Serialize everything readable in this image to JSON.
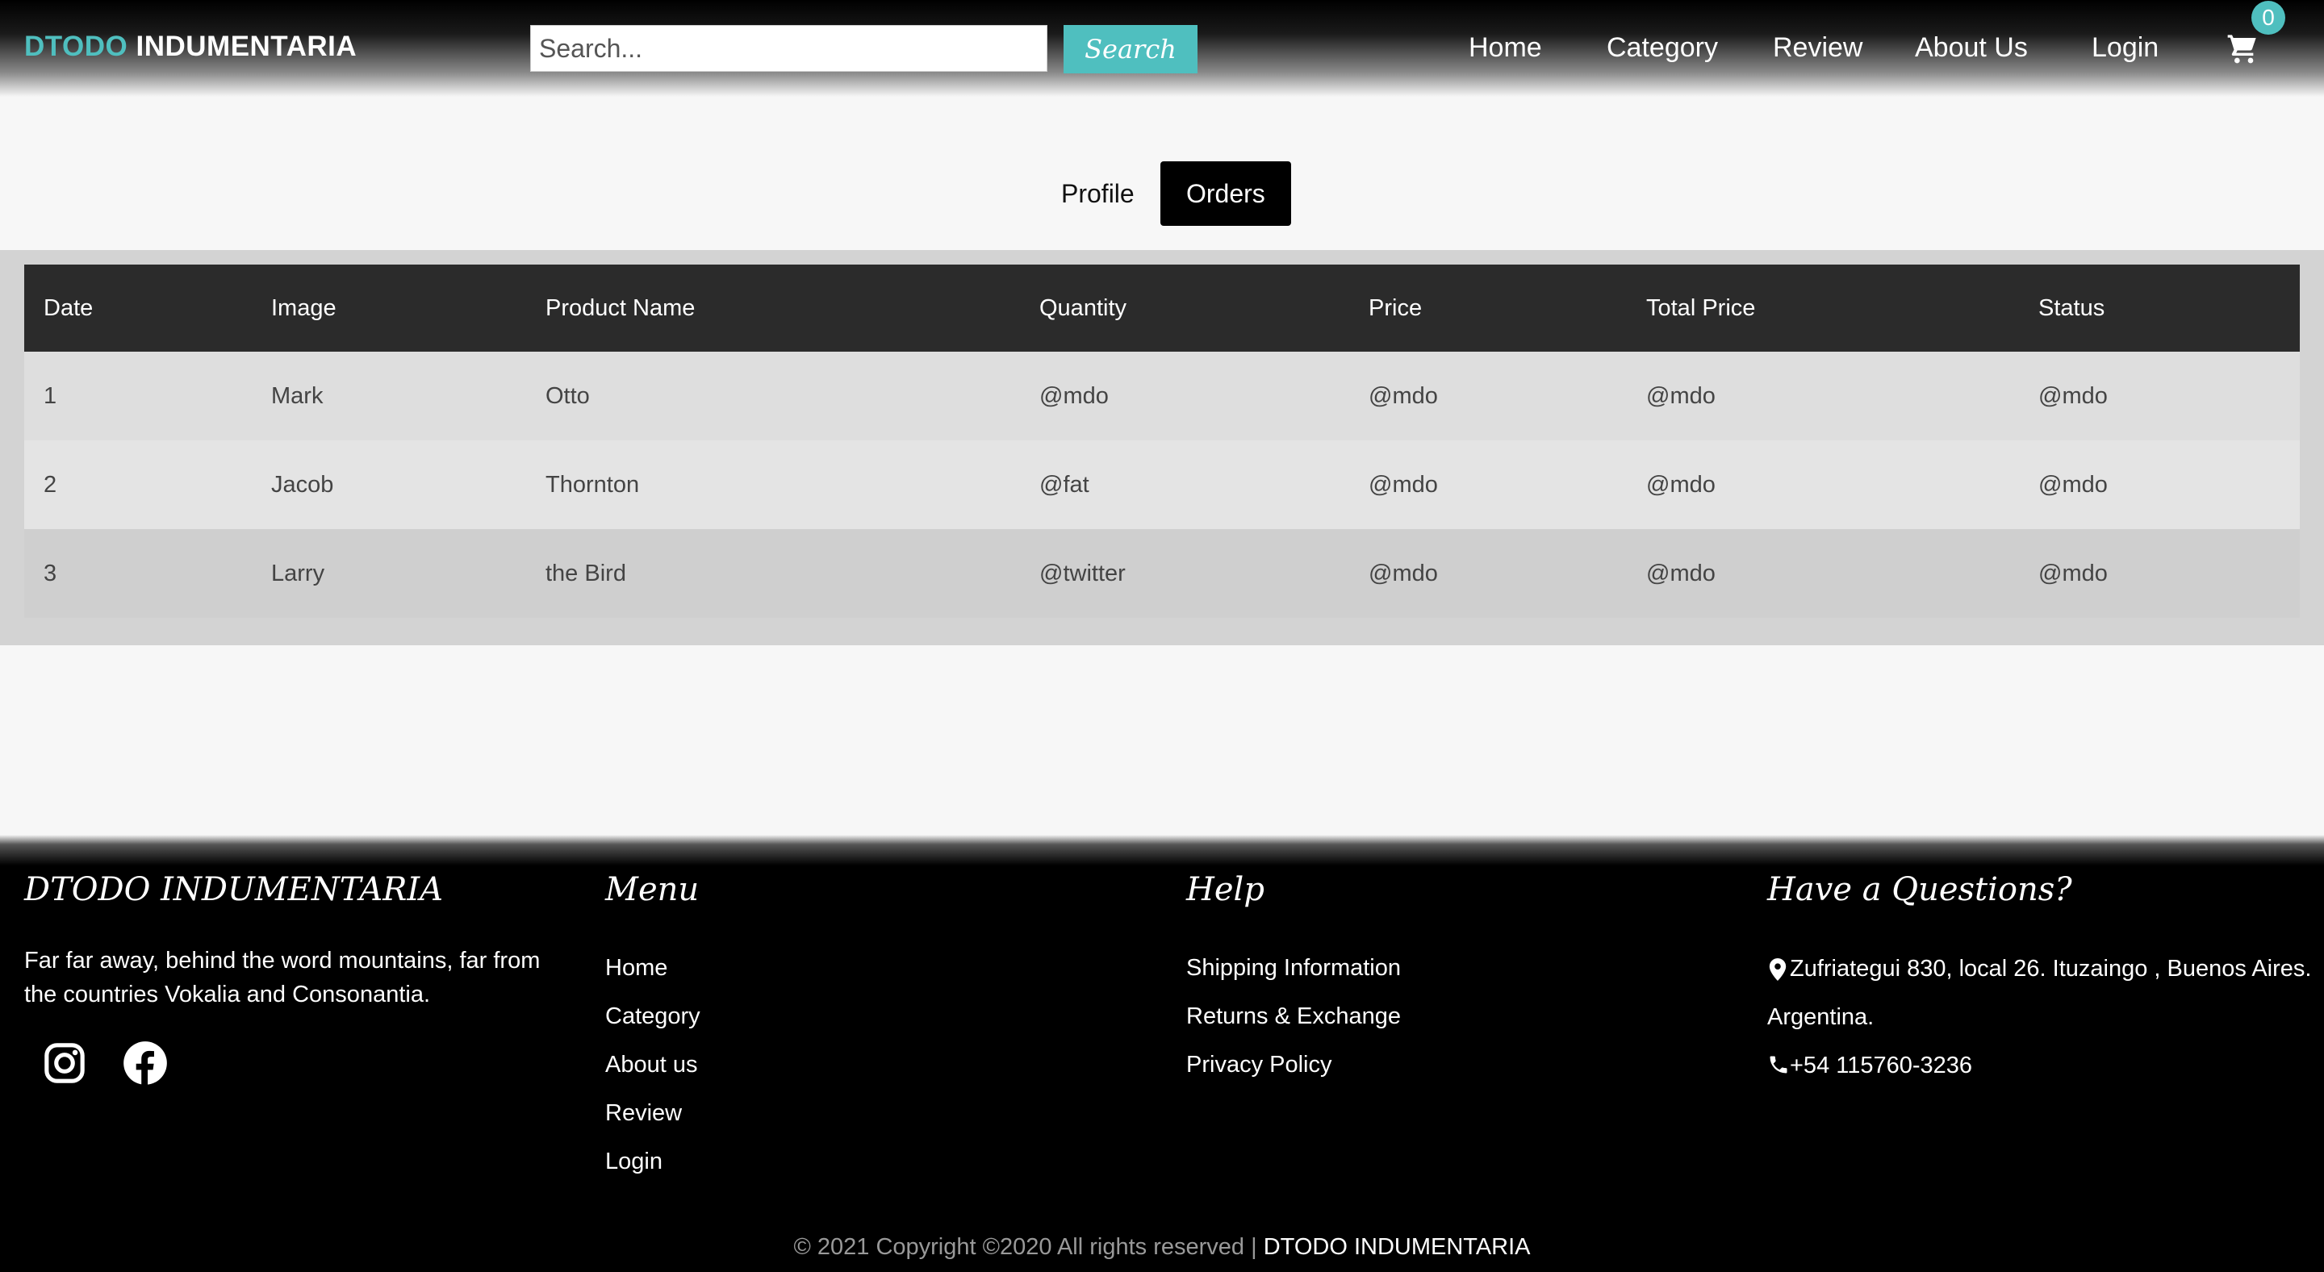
{
  "header": {
    "brand_accent": "DTODO",
    "brand_rest": "INDUMENTARIA",
    "search_placeholder": "Search...",
    "search_button": "Search",
    "nav": [
      "Home",
      "Category",
      "Review",
      "About Us",
      "Login"
    ],
    "cart_count": "0",
    "accent_color": "#4fbfbf"
  },
  "tabs": {
    "profile": "Profile",
    "orders": "Orders",
    "active": "Orders"
  },
  "orders_table": {
    "headers": [
      "Date",
      "Image",
      "Product Name",
      "Quantity",
      "Price",
      "Total Price",
      "Status"
    ],
    "rows": [
      [
        "1",
        "Mark",
        "Otto",
        "@mdo",
        "@mdo",
        "@mdo",
        "@mdo"
      ],
      [
        "2",
        "Jacob",
        "Thornton",
        "@fat",
        "@mdo",
        "@mdo",
        "@mdo"
      ],
      [
        "3",
        "Larry",
        "the Bird",
        "@twitter",
        "@mdo",
        "@mdo",
        "@mdo"
      ]
    ]
  },
  "footer": {
    "brand": {
      "title": "DTODO INDUMENTARIA",
      "description": "Far far away, behind the word mountains, far from the countries Vokalia and Consonantia.",
      "social": [
        "instagram-icon",
        "facebook-icon"
      ]
    },
    "menu": {
      "title": "Menu",
      "items": [
        "Home",
        "Category",
        "About us",
        "Review",
        "Login"
      ]
    },
    "help": {
      "title": "Help",
      "items": [
        "Shipping Information",
        "Returns & Exchange",
        "Privacy Policy"
      ]
    },
    "contact": {
      "title": "Have a Questions?",
      "address_line1": "Zufriategui 830, local 26. Ituzaingo , Buenos Aires.",
      "address_line2": "Argentina.",
      "phone": "+54 115760-3236"
    },
    "copyright_prefix": "© 2021 Copyright ©2020 All rights reserved |",
    "copyright_brand": "DTODO INDUMENTARIA"
  }
}
